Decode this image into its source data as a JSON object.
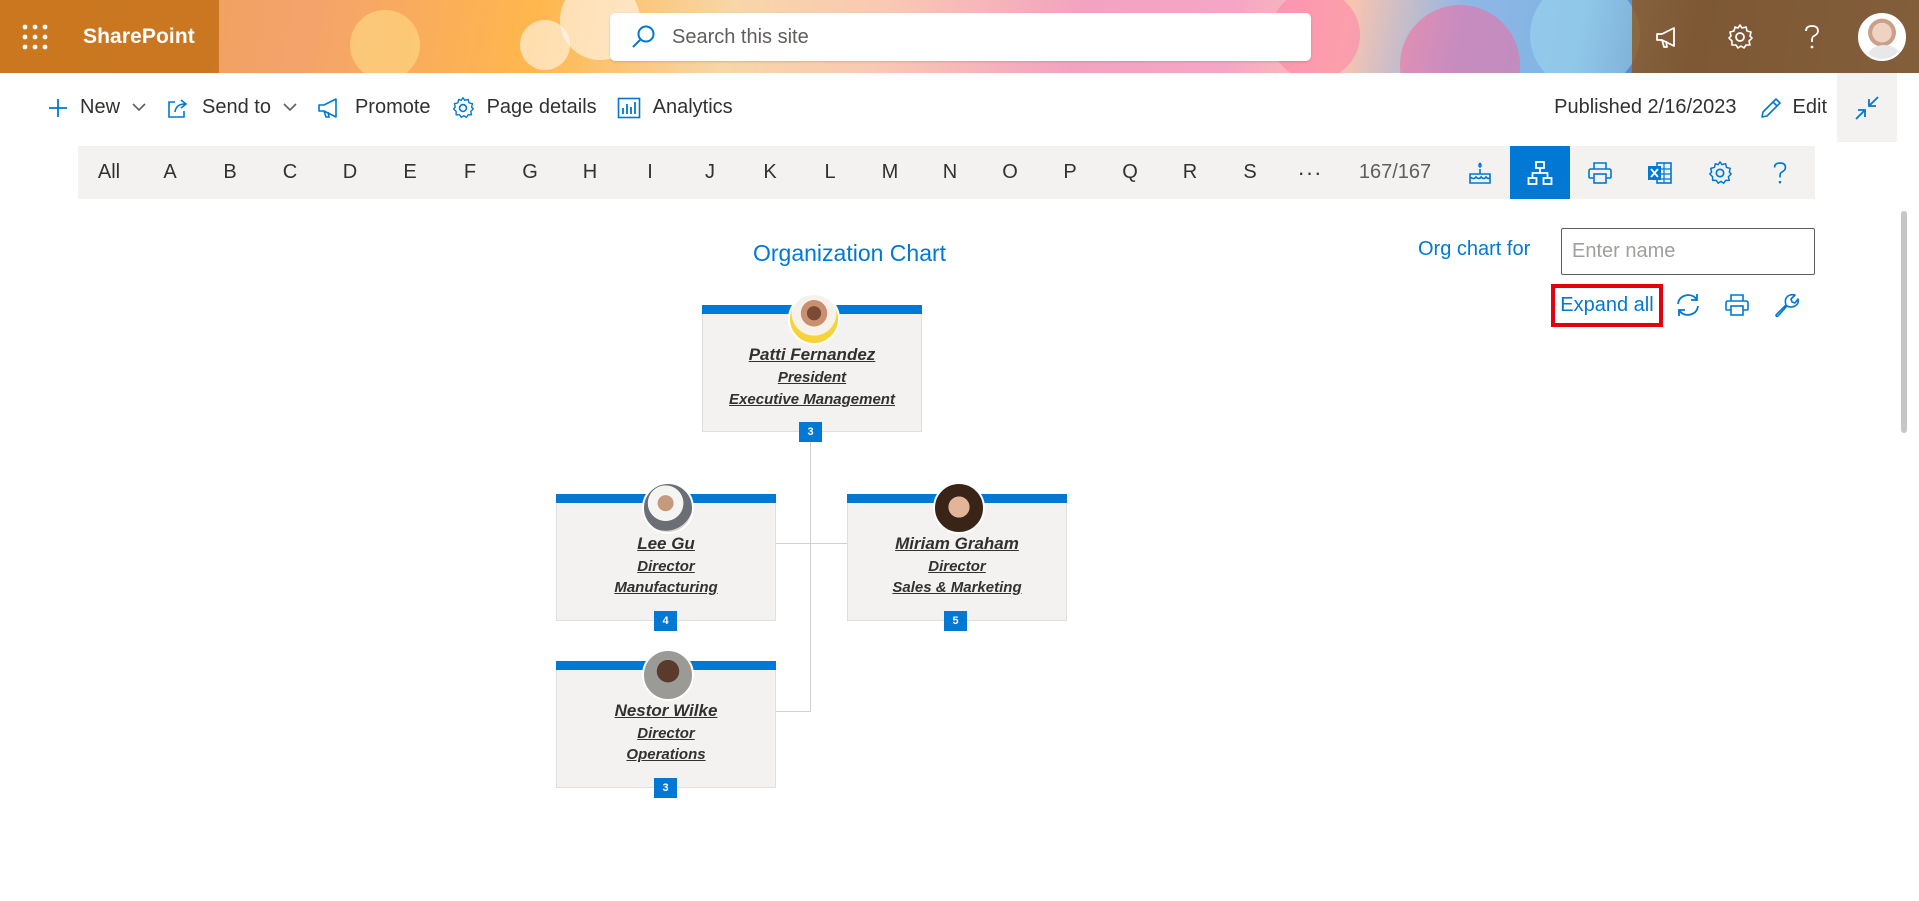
{
  "suite": {
    "brand": "SharePoint",
    "search_placeholder": "Search this site"
  },
  "commands": {
    "new": "New",
    "send_to": "Send to",
    "promote": "Promote",
    "page_details": "Page details",
    "analytics": "Analytics",
    "published": "Published 2/16/2023",
    "edit": "Edit"
  },
  "alphabet": {
    "letters": [
      "All",
      "A",
      "B",
      "C",
      "D",
      "E",
      "F",
      "G",
      "H",
      "I",
      "J",
      "K",
      "L",
      "M",
      "N",
      "O",
      "P",
      "Q",
      "R",
      "S"
    ],
    "more": "···",
    "count": "167/167"
  },
  "org": {
    "title": "Organization Chart",
    "org_chart_for": "Org chart for",
    "name_placeholder": "Enter name",
    "expand_all": "Expand all",
    "people": [
      {
        "name": "Patti Fernandez",
        "title": "President",
        "dept": "Executive Management",
        "reports": "3"
      },
      {
        "name": "Lee Gu",
        "title": "Director",
        "dept": "Manufacturing",
        "reports": "4"
      },
      {
        "name": "Miriam Graham",
        "title": "Director",
        "dept": "Sales & Marketing",
        "reports": "5"
      },
      {
        "name": "Nestor Wilke",
        "title": "Director",
        "dept": "Operations",
        "reports": "3"
      }
    ]
  },
  "colors": {
    "accent": "#0078d4",
    "highlight": "#e3000f"
  }
}
